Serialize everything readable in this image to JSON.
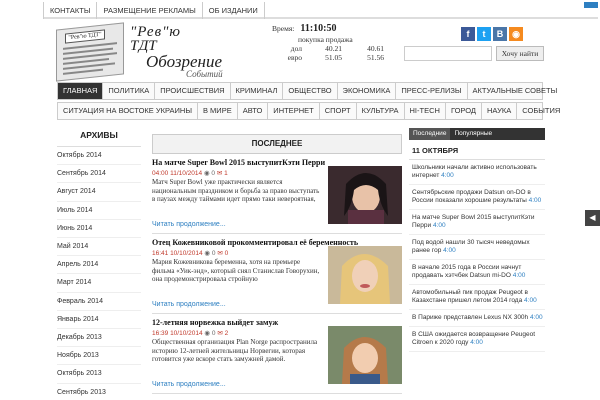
{
  "topnav": [
    "КОНТАКТЫ",
    "РАЗМЕЩЕНИЕ РЕКЛАМЫ",
    "ОБ ИЗДАНИИ"
  ],
  "logo": {
    "paper_tag": "\"Рев\"ю ТДТ\"",
    "line1": "\"Рев\"ю",
    "line2": "ТДТ",
    "line3": "Обозрение",
    "line4": "Событий"
  },
  "rates": {
    "time_label": "Время:",
    "time_value": "11:10:50",
    "header": "покупка продажа",
    "rows": [
      {
        "currency": "дол",
        "buy": "40.21",
        "sell": "40.61"
      },
      {
        "currency": "евро",
        "buy": "51.05",
        "sell": "51.56"
      }
    ]
  },
  "social": [
    {
      "icon": "facebook-icon",
      "glyph": "f",
      "color": "#3b5998"
    },
    {
      "icon": "twitter-icon",
      "glyph": "t",
      "color": "#1da1f2"
    },
    {
      "icon": "vk-icon",
      "glyph": "В",
      "color": "#4a76a8"
    },
    {
      "icon": "rss-icon",
      "glyph": "◉",
      "color": "#f58a1f"
    }
  ],
  "search": {
    "placeholder": "",
    "button": "Хочу найти"
  },
  "mainnav": [
    "ГЛАВНАЯ",
    "ПОЛИТИКА",
    "ПРОИСШЕСТВИЯ",
    "КРИМИНАЛ",
    "ОБЩЕСТВО",
    "ЭКОНОМИКА",
    "ПРЕСС-РЕЛИЗЫ",
    "АКТУАЛЬНЫЕ СОВЕТЫ"
  ],
  "subnav": [
    "СИТУАЦИЯ НА ВОСТОКЕ УКРАИНЫ",
    "В МИРЕ",
    "АВТО",
    "ИНТЕРНЕТ",
    "СПОРТ",
    "КУЛЬТУРА",
    "HI-TECH",
    "ГОРОД",
    "НАУКА",
    "СОБЫТИЯ"
  ],
  "archive": {
    "title": "АРХИВЫ",
    "items": [
      "Октябрь 2014",
      "Сентябрь 2014",
      "Август 2014",
      "Июль 2014",
      "Июнь 2014",
      "Май 2014",
      "Апрель 2014",
      "Март 2014",
      "Февраль 2014",
      "Январь 2014",
      "Декабрь 2013",
      "Ноябрь 2013",
      "Октябрь 2013",
      "Сентябрь 2013"
    ]
  },
  "latest": {
    "title": "ПОСЛЕДНЕЕ",
    "articles": [
      {
        "title": "На матче Super Bowl 2015 выступитКэти Перри",
        "date": "04:00 11/10/2014",
        "views": "0",
        "comments": "1",
        "text": "Матч Super Bowl уже практически является национальным праздником и борьба за право выступать в паузах между таймами идет прямо таки невероятная,",
        "more": "Читать продолжение..."
      },
      {
        "title": "Отец Кожевниковой прокомментировал её беременность",
        "date": "16:41 10/10/2014",
        "views": "0",
        "comments": "0",
        "text": "Мария Кожевникова беременна, хотя на премьере фильма «Уик-энд», который снял Станислав Говорухин, она продемонстрировала стройную",
        "more": "Читать продолжение..."
      },
      {
        "title": "12-летняя норвежка выйдет замуж",
        "date": "16:39 10/10/2014",
        "views": "0",
        "comments": "2",
        "text": "Общественная организация Plan Norge распространила историю 12-летней жительницы Норвегии, которая готовится уже вскоре стать замужней дамой.",
        "more": "Читать продолжение..."
      }
    ]
  },
  "sidebar": {
    "tabs": [
      "Последние",
      "Популярные"
    ],
    "date": "11 ОКТЯБРЯ",
    "items": [
      {
        "text": "Школьники начали активно использовать интернет",
        "time": "4:00"
      },
      {
        "text": "Сентябрьские продажи Datsun on-DO в России показали хорошие результаты",
        "time": "4:00"
      },
      {
        "text": "На матче Super Bowl 2015 выступитКэти Перри",
        "time": "4:00"
      },
      {
        "text": "Под водой нашли 30 тысяч неведомых ранее гор",
        "time": "4:00"
      },
      {
        "text": "В начале 2015 года в России начнут продавать хэтчбек Datsun mi-DO",
        "time": "4:00"
      },
      {
        "text": "Автомобильный пик продаж Peugeot в Казахстане пришел летом 2014 года",
        "time": "4:00"
      },
      {
        "text": "В Париже представлен Lexus NX 300h",
        "time": "4:00"
      },
      {
        "text": "В США ожидается возвращение Peugeot Citroen к 2020 году",
        "time": "4:00"
      }
    ]
  }
}
